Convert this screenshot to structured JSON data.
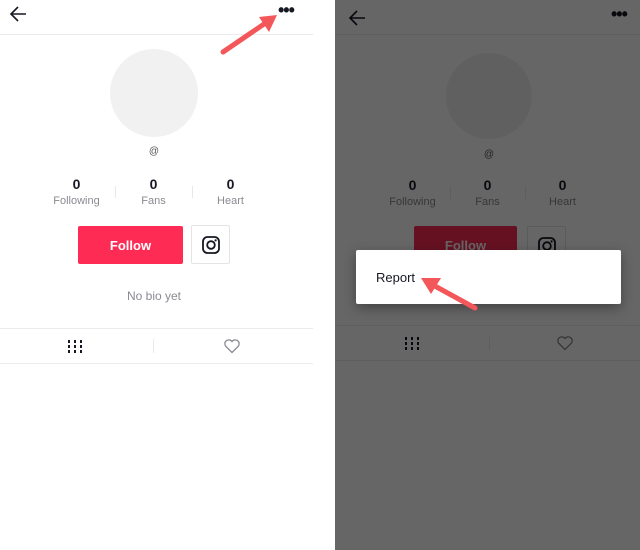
{
  "profile": {
    "handle": "@",
    "stats": [
      {
        "value": "0",
        "label": "Following"
      },
      {
        "value": "0",
        "label": "Fans"
      },
      {
        "value": "0",
        "label": "Heart"
      }
    ],
    "follow_label": "Follow",
    "bio": "No bio yet"
  },
  "header": {
    "back_icon": "arrow-left-icon",
    "more_label": "•••"
  },
  "tabs": [
    {
      "icon": "videos-grid-icon"
    },
    {
      "icon": "heart-icon"
    }
  ],
  "menu": {
    "items": [
      {
        "label": "Report"
      }
    ]
  },
  "colors": {
    "accent": "#fe2c55",
    "annotation_arrow": "#f4575a",
    "overlay": "#666666"
  }
}
